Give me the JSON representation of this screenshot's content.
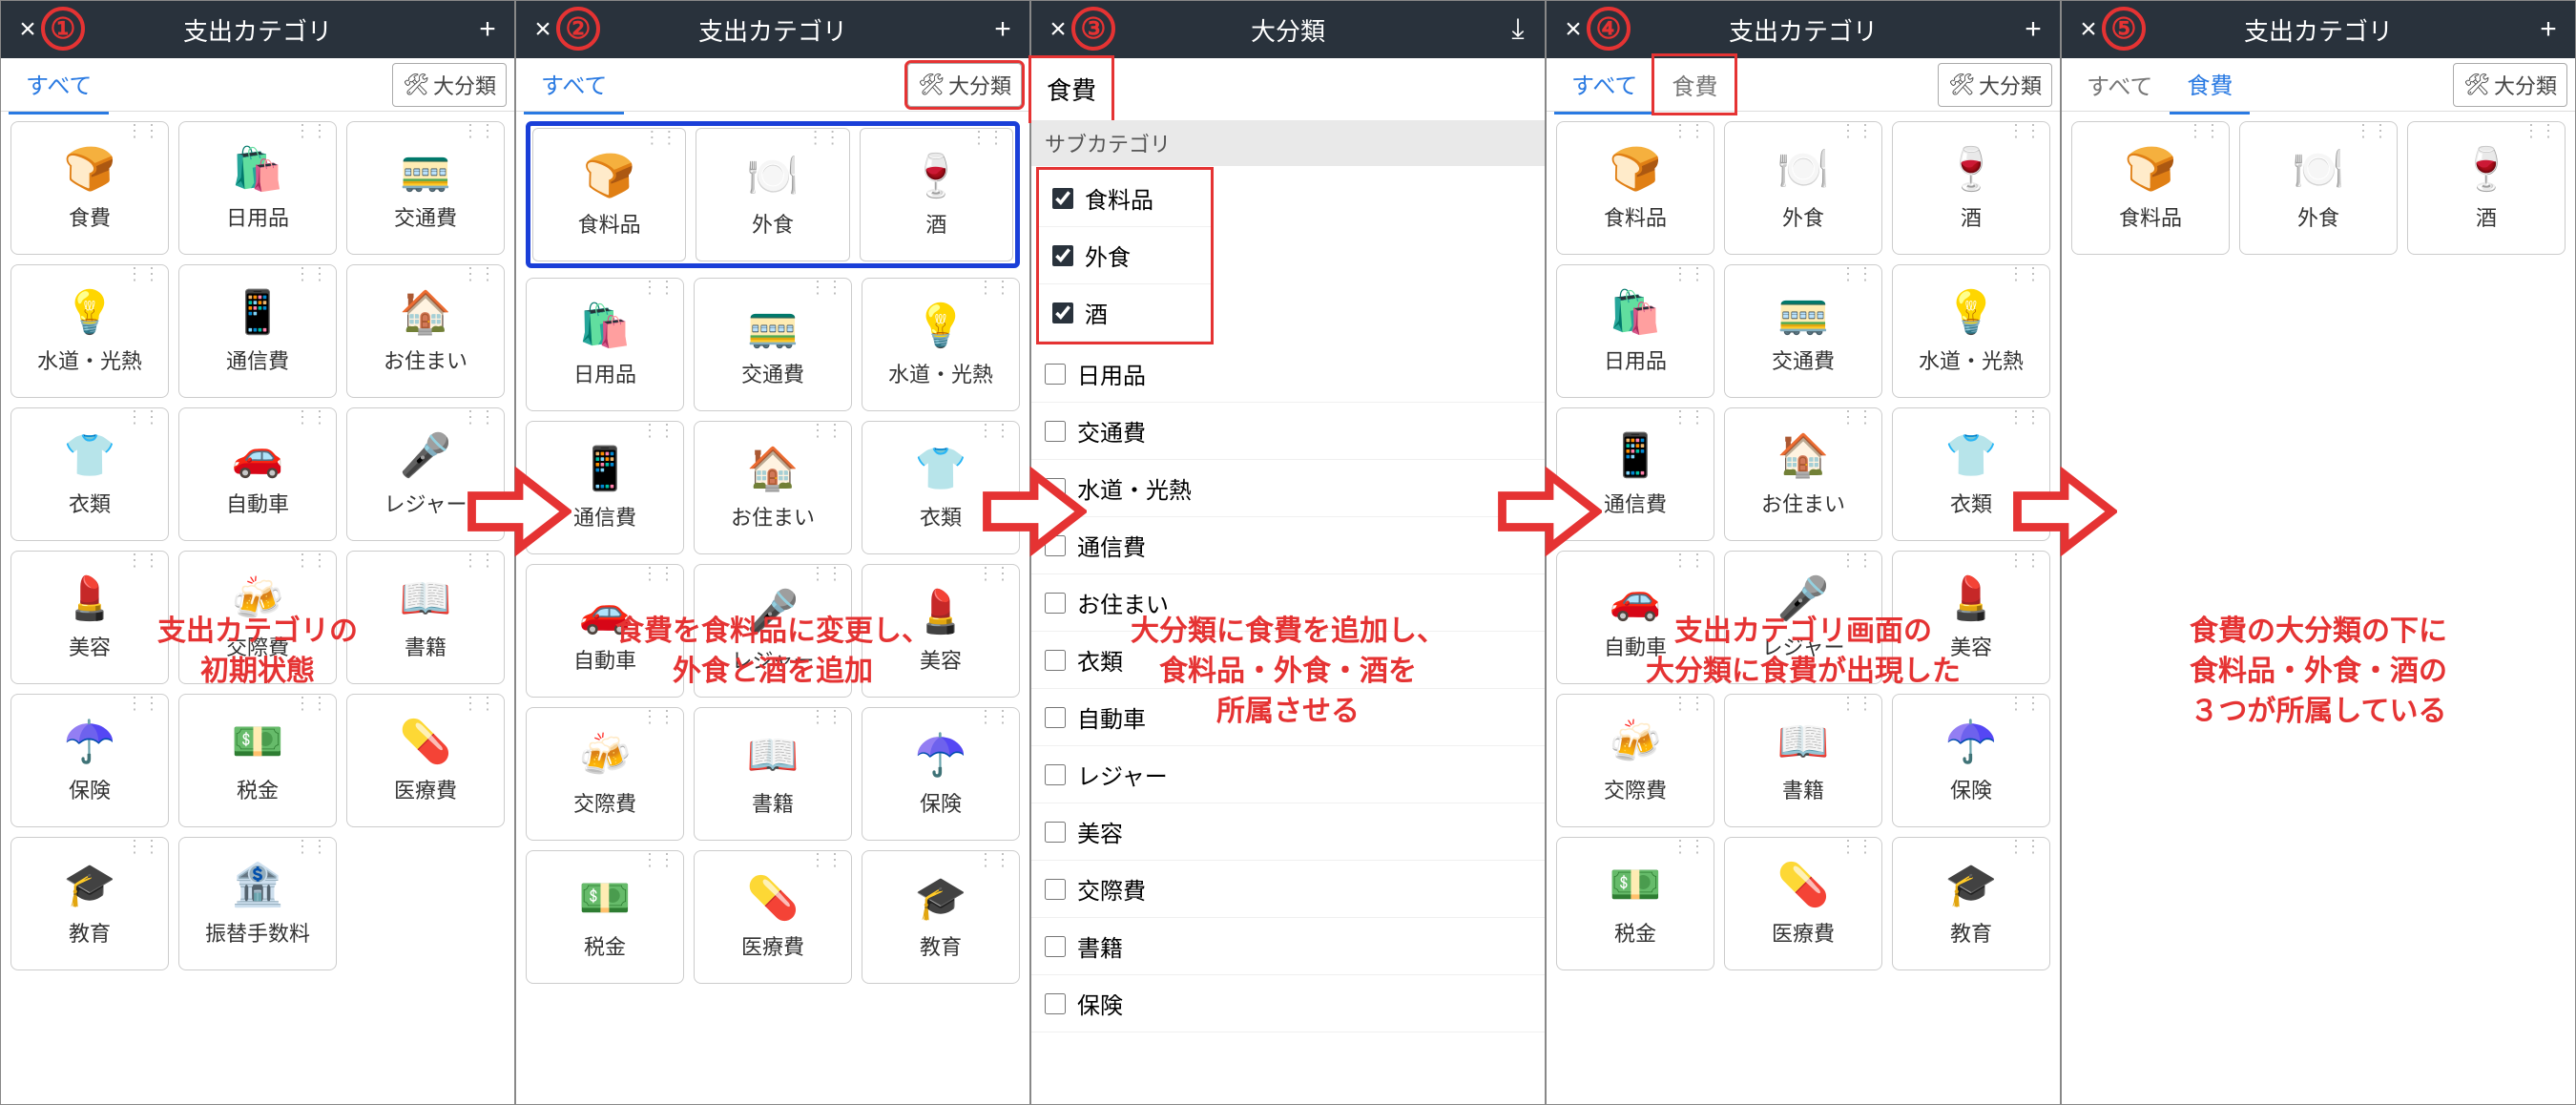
{
  "step_labels": [
    "①",
    "②",
    "③",
    "④",
    "⑤"
  ],
  "header": {
    "title_cat": "支出カテゴリ",
    "title_big": "大分類",
    "close": "×",
    "plus": "+",
    "save": "⤓"
  },
  "tabs": {
    "all": "すべて",
    "food": "食費"
  },
  "bigcat_btn": "大分類",
  "tools_icon": "🛠",
  "panel3": {
    "name": "食費",
    "sub_label": "サブカテゴリ",
    "rows": [
      {
        "label": "食料品",
        "checked": true
      },
      {
        "label": "外食",
        "checked": true
      },
      {
        "label": "酒",
        "checked": true
      },
      {
        "label": "日用品",
        "checked": false
      },
      {
        "label": "交通費",
        "checked": false
      },
      {
        "label": "水道・光熱",
        "checked": false
      },
      {
        "label": "通信費",
        "checked": false
      },
      {
        "label": "お住まい",
        "checked": false
      },
      {
        "label": "衣類",
        "checked": false
      },
      {
        "label": "自動車",
        "checked": false
      },
      {
        "label": "レジャー",
        "checked": false
      },
      {
        "label": "美容",
        "checked": false
      },
      {
        "label": "交際費",
        "checked": false
      },
      {
        "label": "書籍",
        "checked": false
      },
      {
        "label": "保険",
        "checked": false
      }
    ]
  },
  "cards1": [
    {
      "icon": "🍞",
      "label": "食費"
    },
    {
      "icon": "🛍️",
      "label": "日用品"
    },
    {
      "icon": "🚃",
      "label": "交通費"
    },
    {
      "icon": "💡",
      "label": "水道・光熱"
    },
    {
      "icon": "📱",
      "label": "通信費"
    },
    {
      "icon": "🏠",
      "label": "お住まい"
    },
    {
      "icon": "👕",
      "label": "衣類"
    },
    {
      "icon": "🚗",
      "label": "自動車"
    },
    {
      "icon": "🎤",
      "label": "レジャー"
    },
    {
      "icon": "💄",
      "label": "美容"
    },
    {
      "icon": "🍻",
      "label": "交際費"
    },
    {
      "icon": "📖",
      "label": "書籍"
    },
    {
      "icon": "☂️",
      "label": "保険"
    },
    {
      "icon": "💵",
      "label": "税金"
    },
    {
      "icon": "💊",
      "label": "医療費"
    },
    {
      "icon": "🎓",
      "label": "教育"
    },
    {
      "icon": "🏦",
      "label": "振替手数料"
    }
  ],
  "cards2_top": [
    {
      "icon": "🍞",
      "label": "食料品"
    },
    {
      "icon": "🍽️",
      "label": "外食"
    },
    {
      "icon": "🍷",
      "label": "酒"
    }
  ],
  "cards2_rest": [
    {
      "icon": "🛍️",
      "label": "日用品"
    },
    {
      "icon": "🚃",
      "label": "交通費"
    },
    {
      "icon": "💡",
      "label": "水道・光熱"
    },
    {
      "icon": "📱",
      "label": "通信費"
    },
    {
      "icon": "🏠",
      "label": "お住まい"
    },
    {
      "icon": "👕",
      "label": "衣類"
    },
    {
      "icon": "🚗",
      "label": "自動車"
    },
    {
      "icon": "🎤",
      "label": "レジャー"
    },
    {
      "icon": "💄",
      "label": "美容"
    },
    {
      "icon": "🍻",
      "label": "交際費"
    },
    {
      "icon": "📖",
      "label": "書籍"
    },
    {
      "icon": "☂️",
      "label": "保険"
    },
    {
      "icon": "💵",
      "label": "税金"
    },
    {
      "icon": "💊",
      "label": "医療費"
    },
    {
      "icon": "🎓",
      "label": "教育"
    }
  ],
  "cards5": [
    {
      "icon": "🍞",
      "label": "食料品"
    },
    {
      "icon": "🍽️",
      "label": "外食"
    },
    {
      "icon": "🍷",
      "label": "酒"
    }
  ],
  "captions": [
    "支出カテゴリの\n初期状態",
    "食費を食料品に変更し、\n外食と酒を追加",
    "大分類に食費を追加し、\n食料品・外食・酒を\n所属させる",
    "支出カテゴリ画面の\n大分類に食費が出現した",
    "食費の大分類の下に\n食料品・外食・酒の\n３つが所属している"
  ]
}
